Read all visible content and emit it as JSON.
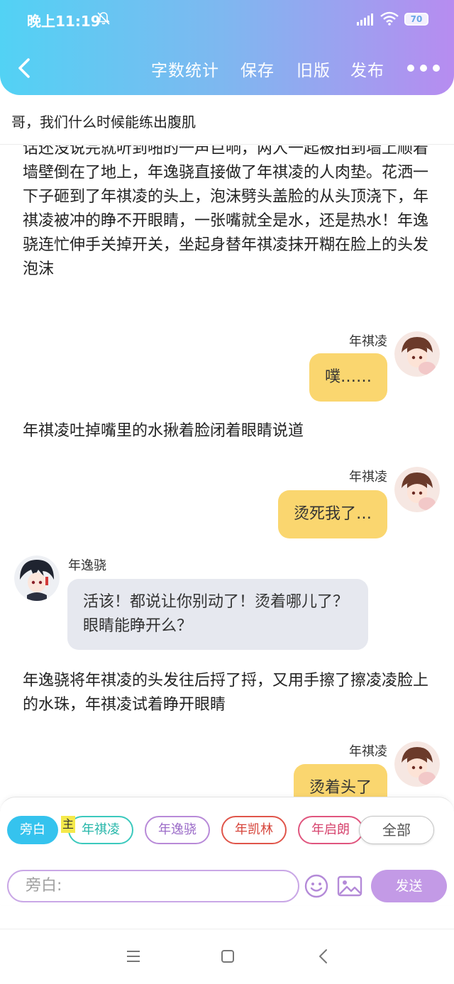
{
  "status_bar": {
    "time": "晚上11:19",
    "battery": "70"
  },
  "header": {
    "nav": {
      "word_count": "字数统计",
      "save": "保存",
      "old_version": "旧版",
      "publish": "发布"
    }
  },
  "title": "哥，我们什么时候能练出腹肌",
  "messages": {
    "narration_1": "话还没说完就听到啪的一声巨响，两人一起被拍到墙上顺着墙壁倒在了地上，年逸骁直接做了年祺凌的人肉垫。花洒一下子砸到了年祺凌的头上，泡沫劈头盖脸的从头顶浇下，年祺凌被冲的睁不开眼睛，一张嘴就全是水，还是热水！年逸骁连忙伸手关掉开关，坐起身替年祺凌抹开糊在脸上的头发泡沫",
    "msg_1": {
      "speaker": "年祺凌",
      "text": "噗……"
    },
    "narration_2": "年祺凌吐掉嘴里的水揪着脸闭着眼睛说道",
    "msg_2": {
      "speaker": "年祺凌",
      "text": "烫死我了…"
    },
    "msg_3": {
      "speaker": "年逸骁",
      "text": "活该！都说让你别动了！烫着哪儿了？眼睛能睁开么？"
    },
    "narration_3": "年逸骁将年祺凌的头发往后捋了捋，又用手擦了擦凌凌脸上的水珠，年祺凌试着睁开眼睛",
    "msg_4": {
      "speaker": "年祺凌",
      "text": "烫着头了"
    }
  },
  "roles": {
    "narrator": "旁白",
    "main_tag": "主",
    "chars": [
      "年祺凌",
      "年逸骁",
      "年凯林",
      "年启朗"
    ],
    "all": "全部"
  },
  "input": {
    "placeholder": "旁白:",
    "send": "发送"
  },
  "colors": {
    "header_gradient_start": "#52d2f4",
    "header_gradient_end": "#b78cf0",
    "bubble_self": "#fad66f",
    "bubble_other": "#e6e8ef",
    "send_button": "#c39ae6",
    "narrator_chip": "#35c3ee"
  }
}
